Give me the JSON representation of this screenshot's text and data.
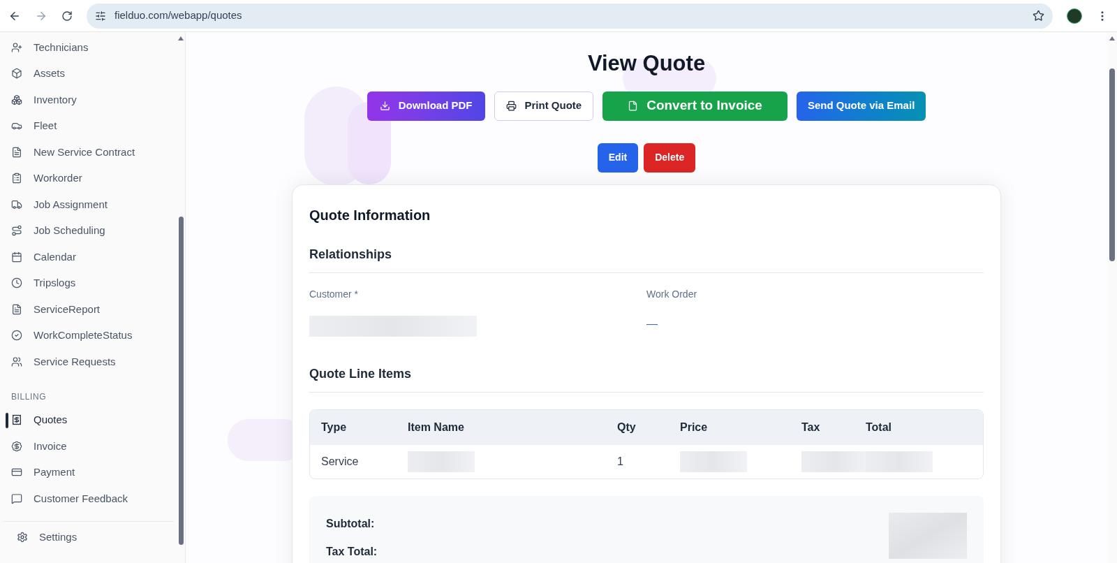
{
  "browser": {
    "url": "fielduo.com/webapp/quotes"
  },
  "sidebar": {
    "items": [
      {
        "label": "Technicians",
        "kind": "person",
        "selected": false
      },
      {
        "label": "Assets",
        "kind": "box",
        "selected": false
      },
      {
        "label": "Inventory",
        "kind": "boxes",
        "selected": false
      },
      {
        "label": "Fleet",
        "kind": "car",
        "selected": false
      },
      {
        "label": "New Service Contract",
        "kind": "file",
        "selected": false
      },
      {
        "label": "Workorder",
        "kind": "clipboard",
        "selected": false
      },
      {
        "label": "Job Assignment",
        "kind": "truck",
        "selected": false
      },
      {
        "label": "Job Scheduling",
        "kind": "route",
        "selected": false
      },
      {
        "label": "Calendar",
        "kind": "calendar",
        "selected": false
      },
      {
        "label": "Tripslogs",
        "kind": "clock",
        "selected": false
      },
      {
        "label": "ServiceReport",
        "kind": "file",
        "selected": false
      },
      {
        "label": "WorkCompleteStatus",
        "kind": "check",
        "selected": false
      },
      {
        "label": "Service Requests",
        "kind": "users",
        "selected": false
      }
    ],
    "billing_heading": "BILLING",
    "billing_items": [
      {
        "label": "Quotes",
        "kind": "receipt",
        "selected": true
      },
      {
        "label": "Invoice",
        "kind": "dollar",
        "selected": false
      },
      {
        "label": "Payment",
        "kind": "card",
        "selected": false
      },
      {
        "label": "Customer Feedback",
        "kind": "message",
        "selected": false
      }
    ],
    "settings": "Settings"
  },
  "page": {
    "title": "View Quote",
    "actions": [
      {
        "label": "Download PDF",
        "kind": "download"
      },
      {
        "label": "Print Quote",
        "kind": "print"
      },
      {
        "label": "Convert to Invoice",
        "kind": "convert"
      },
      {
        "label": "Send Quote via Email",
        "kind": "email"
      }
    ],
    "secondary_actions": [
      {
        "label": "Edit",
        "kind": "edit"
      },
      {
        "label": "Delete",
        "kind": "delete"
      }
    ]
  },
  "card": {
    "title": "Quote Information",
    "relationships_heading": "Relationships",
    "fields": [
      {
        "label": "Customer *",
        "kind": "blurred"
      },
      {
        "label": "Work Order",
        "kind": "text",
        "value": "—"
      }
    ],
    "line_items_heading": "Quote Line Items",
    "table": {
      "columns": [
        "Type",
        "Item Name",
        "Qty",
        "Price",
        "Tax",
        "Total"
      ],
      "rows": [
        [
          {
            "kind": "text",
            "text": "Service"
          },
          {
            "kind": "blurred"
          },
          {
            "kind": "text",
            "text": "1"
          },
          {
            "kind": "blurred"
          },
          {
            "kind": "blurred"
          },
          {
            "kind": "blurred"
          }
        ]
      ]
    },
    "totals": [
      "Subtotal:",
      "Tax Total:"
    ]
  }
}
